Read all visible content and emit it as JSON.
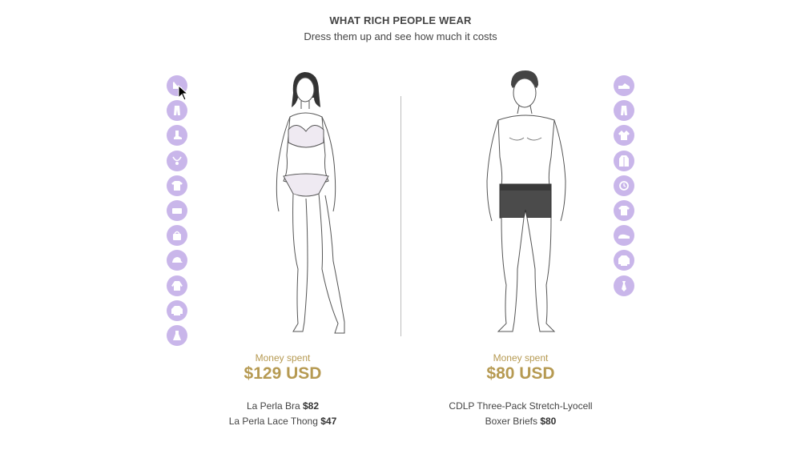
{
  "header": {
    "title": "WHAT RICH PEOPLE WEAR",
    "subtitle": "Dress them up and see how much it costs"
  },
  "left_panel": {
    "icons": [
      "heel-shoe-icon",
      "pants-icon",
      "boot-icon",
      "necklace-icon",
      "tshirt-icon",
      "clutch-icon",
      "handbag-icon",
      "cap-icon",
      "blouse-icon",
      "jacket-icon",
      "dress-icon"
    ],
    "money_label": "Money spent",
    "money_value": "$129 USD",
    "items": [
      {
        "name": "La Perla Bra",
        "price": "$82"
      },
      {
        "name": "La Perla Lace Thong",
        "price": "$47"
      }
    ]
  },
  "right_panel": {
    "icons": [
      "sneaker-icon",
      "pants-icon",
      "shirt-icon",
      "coat-icon",
      "watch-icon",
      "tshirt-icon",
      "loafer-icon",
      "sweater-icon",
      "tie-icon"
    ],
    "money_label": "Money spent",
    "money_value": "$80 USD",
    "items": [
      {
        "name": "CDLP Three-Pack Stretch-Lyocell",
        "price": ""
      },
      {
        "name": "Boxer Briefs",
        "price": "$80"
      }
    ]
  },
  "colors": {
    "icon_bg": "#c9b6ea",
    "accent_gold": "#b69a52"
  }
}
